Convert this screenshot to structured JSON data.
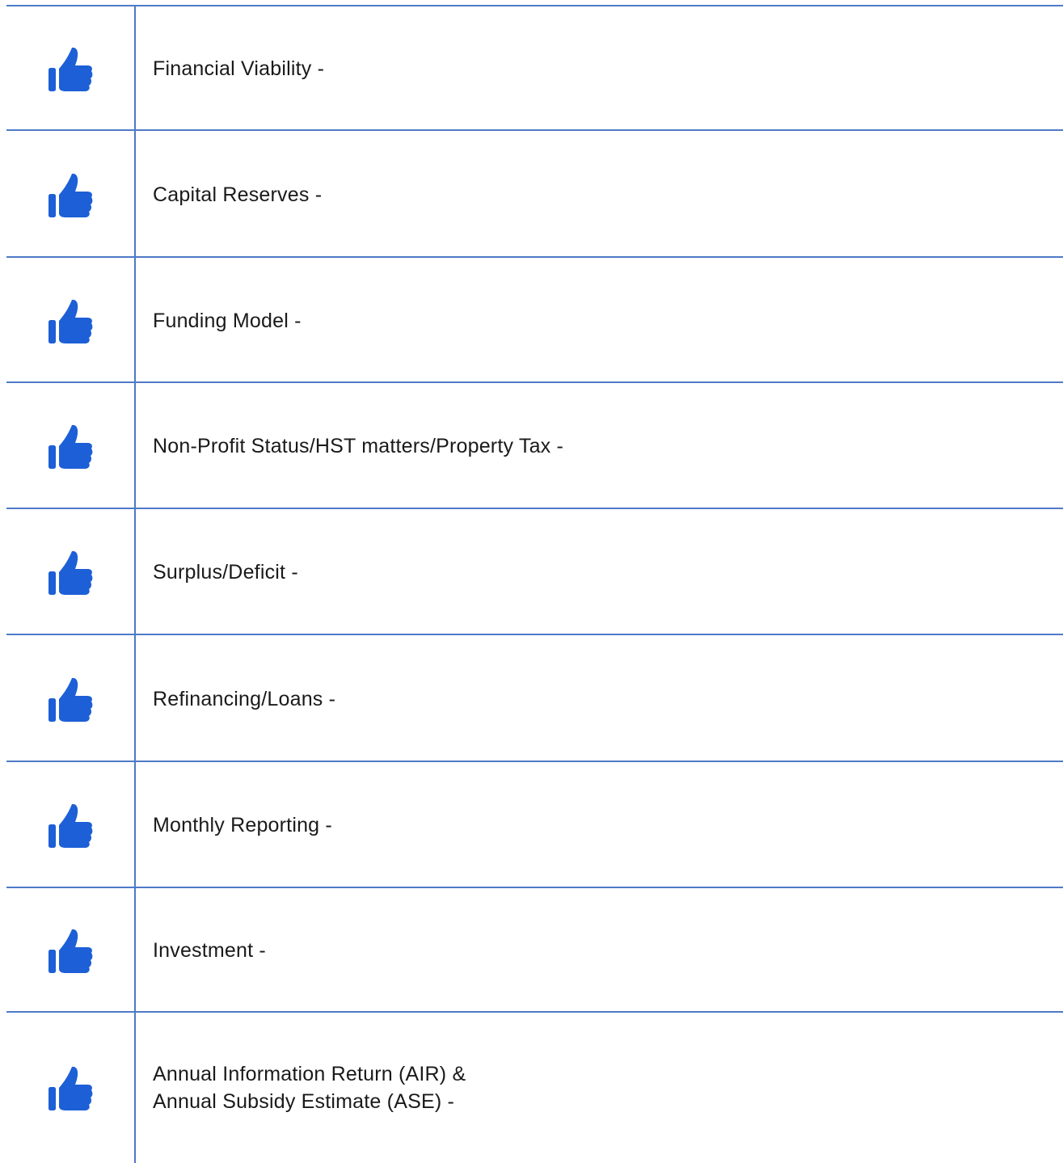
{
  "rows": [
    {
      "icon": "thumbs-up-icon",
      "label": "Financial Viability -"
    },
    {
      "icon": "thumbs-up-icon",
      "label": "Capital Reserves -"
    },
    {
      "icon": "thumbs-up-icon",
      "label": "Funding Model -"
    },
    {
      "icon": "thumbs-up-icon",
      "label": "Non-Profit Status/HST matters/Property Tax -"
    },
    {
      "icon": "thumbs-up-icon",
      "label": "Surplus/Deficit -"
    },
    {
      "icon": "thumbs-up-icon",
      "label": "Refinancing/Loans -"
    },
    {
      "icon": "thumbs-up-icon",
      "label": "Monthly Reporting -"
    },
    {
      "icon": "thumbs-up-icon",
      "label": "Investment -"
    },
    {
      "icon": "thumbs-up-icon",
      "label": "Annual Information Return (AIR) &\nAnnual Subsidy Estimate (ASE) -"
    }
  ],
  "colors": {
    "rule": "#4e7ac7",
    "icon": "#1d5fd6"
  }
}
